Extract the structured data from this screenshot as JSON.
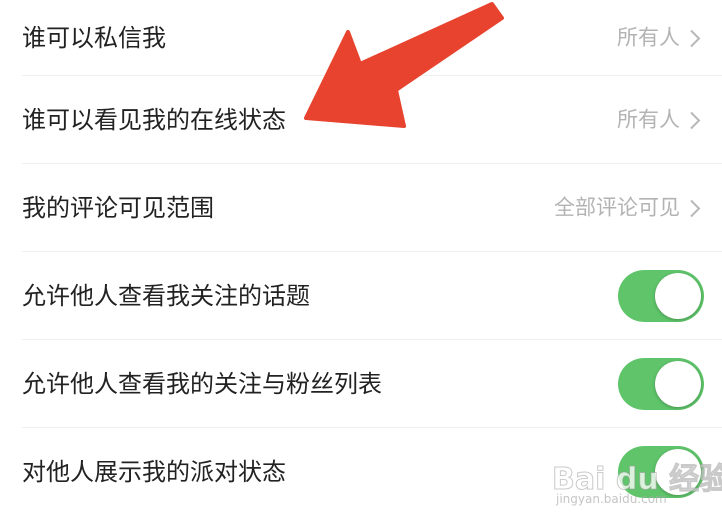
{
  "settings": {
    "rows": [
      {
        "label": "谁可以私信我",
        "value": "所有人",
        "type": "nav"
      },
      {
        "label": "谁可以看见我的在线状态",
        "value": "所有人",
        "type": "nav"
      },
      {
        "label": "我的评论可见范围",
        "value": "全部评论可见",
        "type": "nav"
      },
      {
        "label": "允许他人查看我关注的话题",
        "type": "toggle",
        "on": true
      },
      {
        "label": "允许他人查看我的关注与粉丝列表",
        "type": "toggle",
        "on": true
      },
      {
        "label": "对他人展示我的派对状态",
        "type": "toggle",
        "on": true
      }
    ]
  },
  "watermark": {
    "brand": "Bai du 经验",
    "sub": "jingyan.baidu.com"
  },
  "colors": {
    "toggle_on": "#5fc46a",
    "annotation_arrow": "#e8432e",
    "value_text": "#b3b3b3",
    "label_text": "#222222"
  },
  "icons": {
    "chevron": "chevron-right-icon",
    "annotation": "red-arrow-annotation"
  }
}
